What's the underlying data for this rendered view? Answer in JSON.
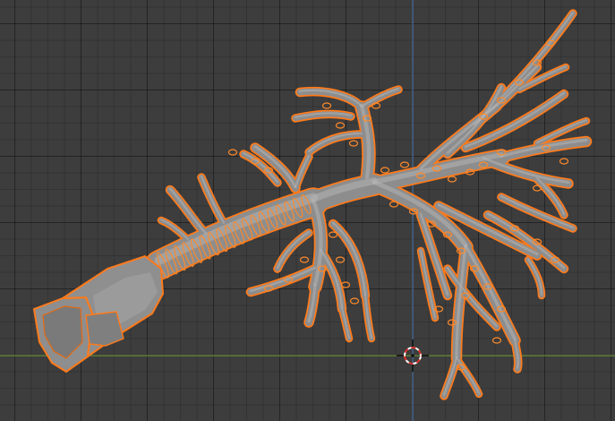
{
  "viewport": {
    "grid": "on",
    "colors": {
      "background": "#3d3d3d",
      "x_axis": "#6b8f3a",
      "z_axis": "#4a6f9b",
      "selection_outline": "#ff7a1a",
      "mesh_surface": "#8d8d8d"
    }
  },
  "object": {
    "kind": "airway-tree-mesh",
    "selected": true
  },
  "cursor": {
    "icon": "3d-cursor-icon"
  }
}
